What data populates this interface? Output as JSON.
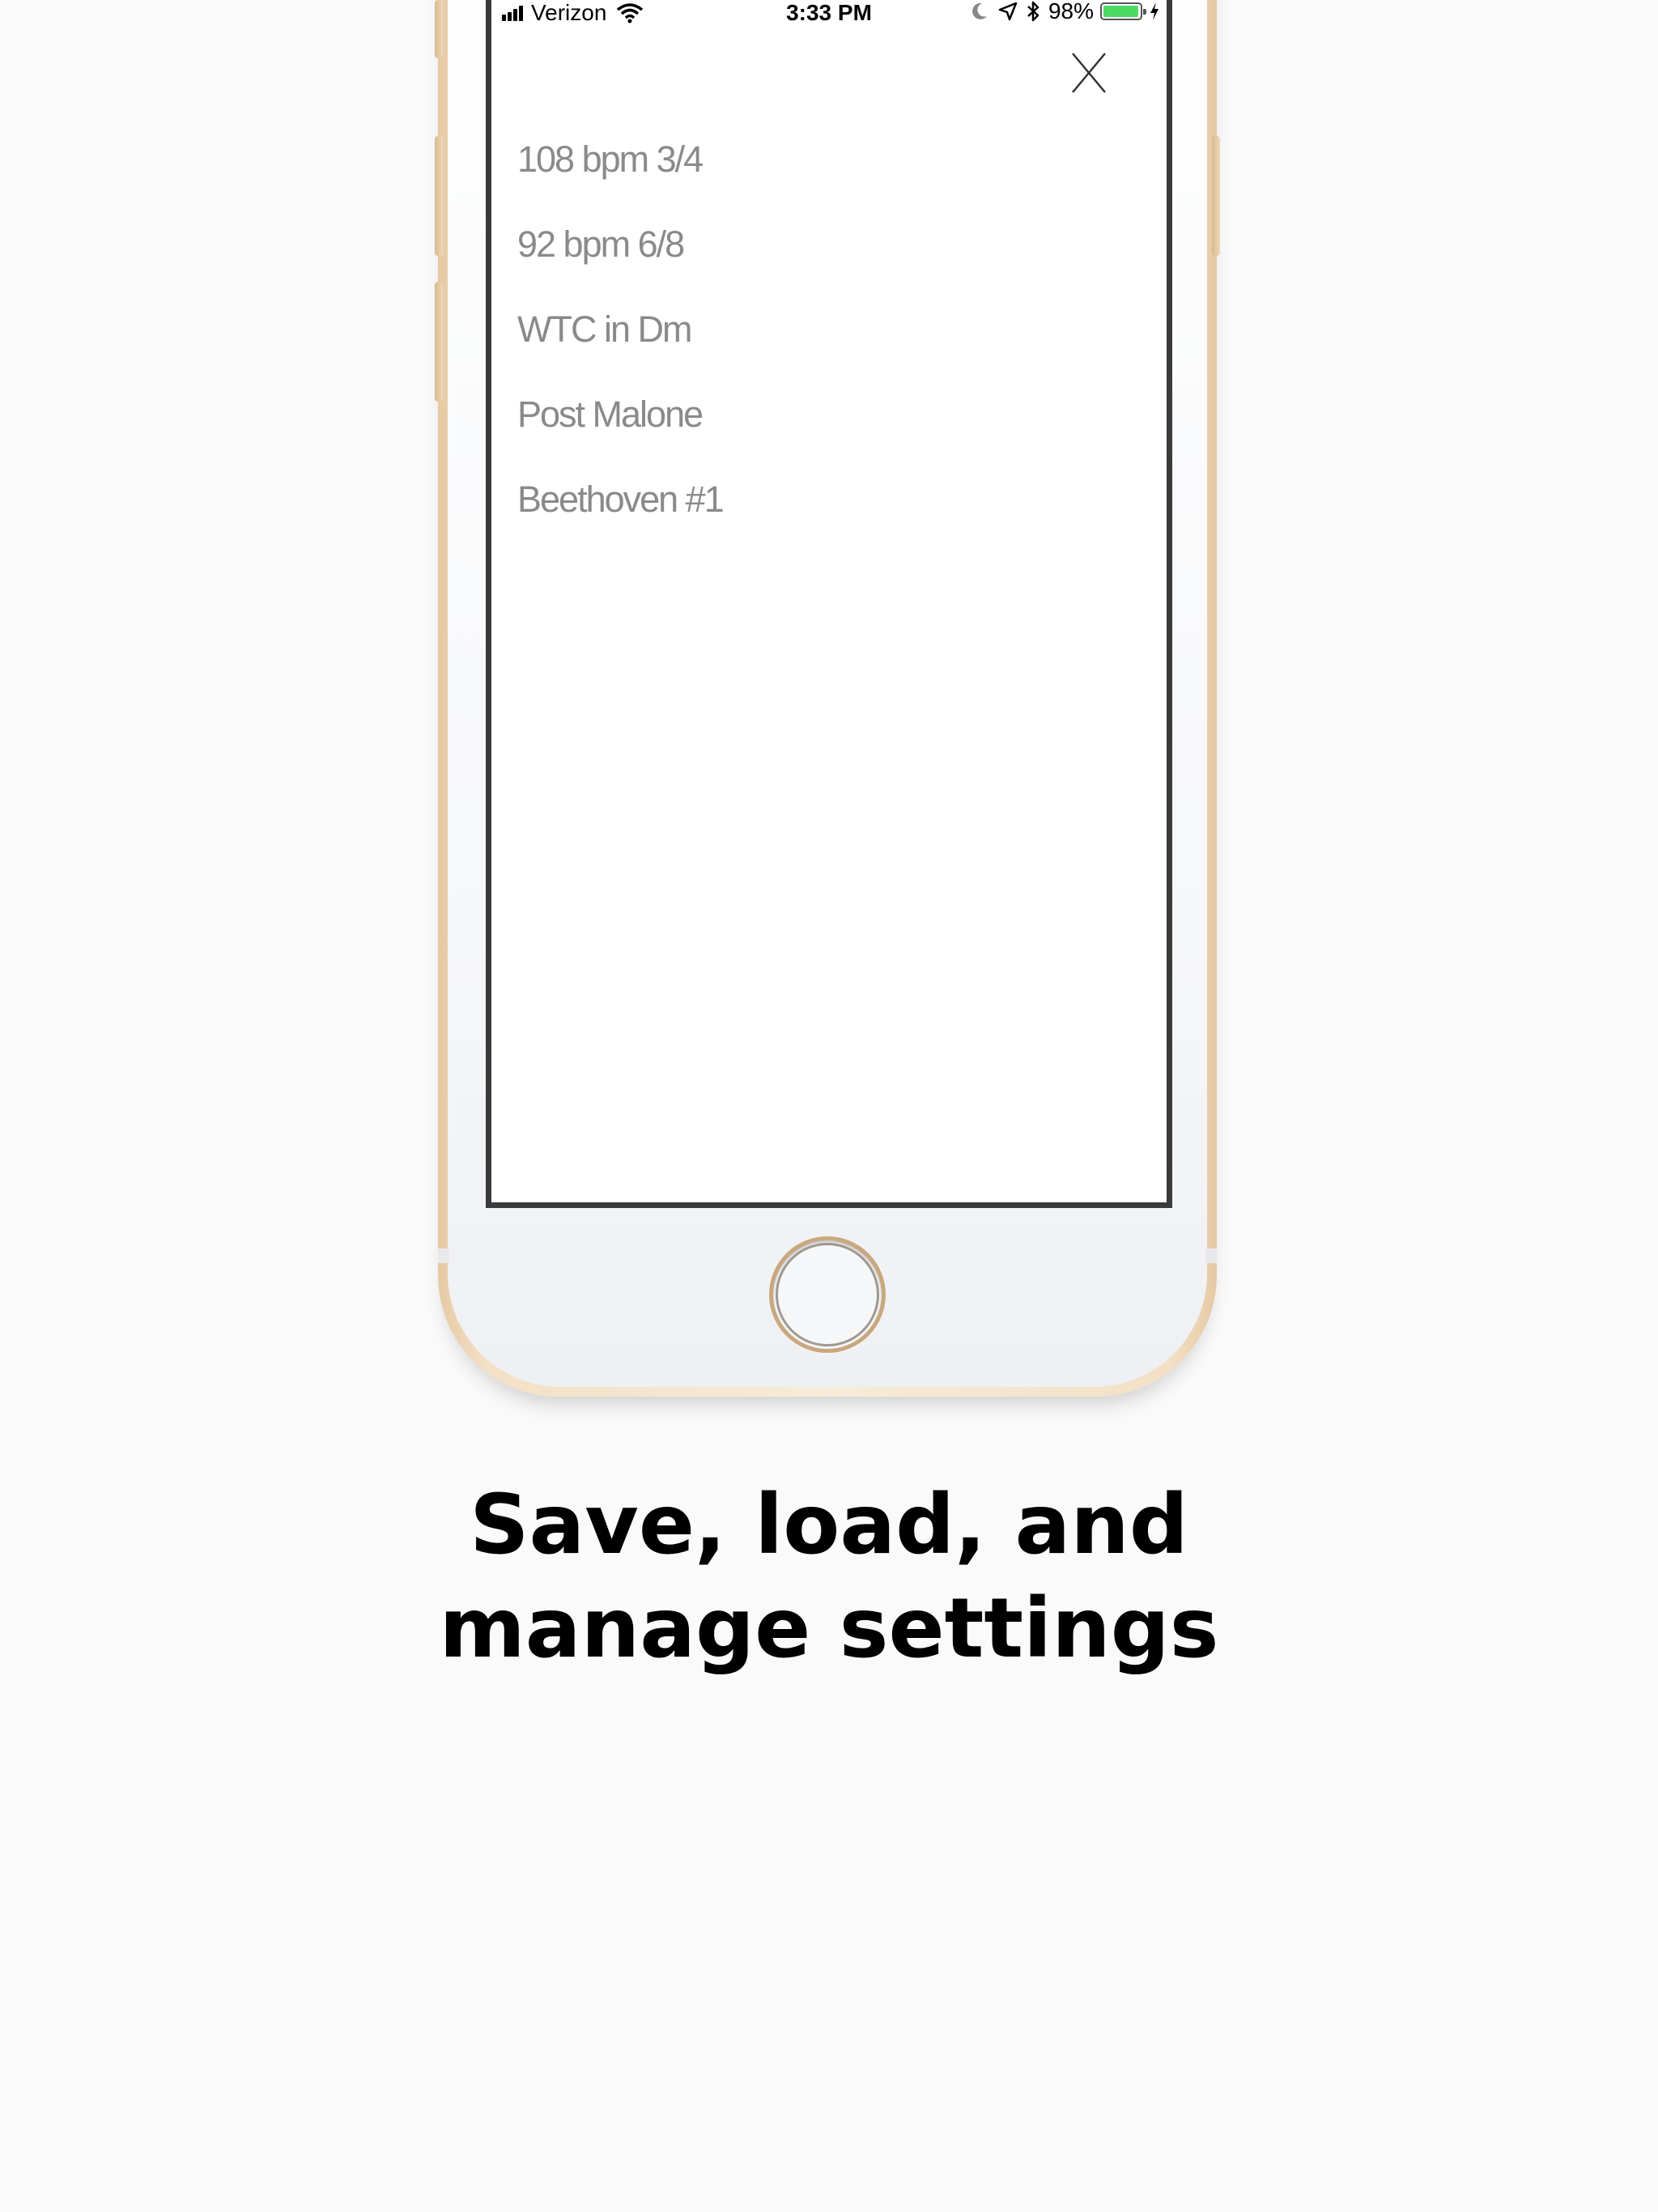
{
  "status_bar": {
    "carrier": "Verizon",
    "time": "3:33 PM",
    "battery_percent": "98%",
    "battery_level": 0.98,
    "battery_color": "#4cd964"
  },
  "close_icon": "close-icon",
  "presets": [
    {
      "label": "108 bpm 3/4"
    },
    {
      "label": "92 bpm 6/8"
    },
    {
      "label": "WTC in Dm"
    },
    {
      "label": "Post Malone"
    },
    {
      "label": "Beethoven #1"
    }
  ],
  "caption": {
    "line1": "Save, load, and",
    "line2": "manage settings"
  },
  "colors": {
    "background": "#fafafa",
    "phone_gold": "#e6c9a3",
    "preset_text": "#8a8a8a"
  }
}
